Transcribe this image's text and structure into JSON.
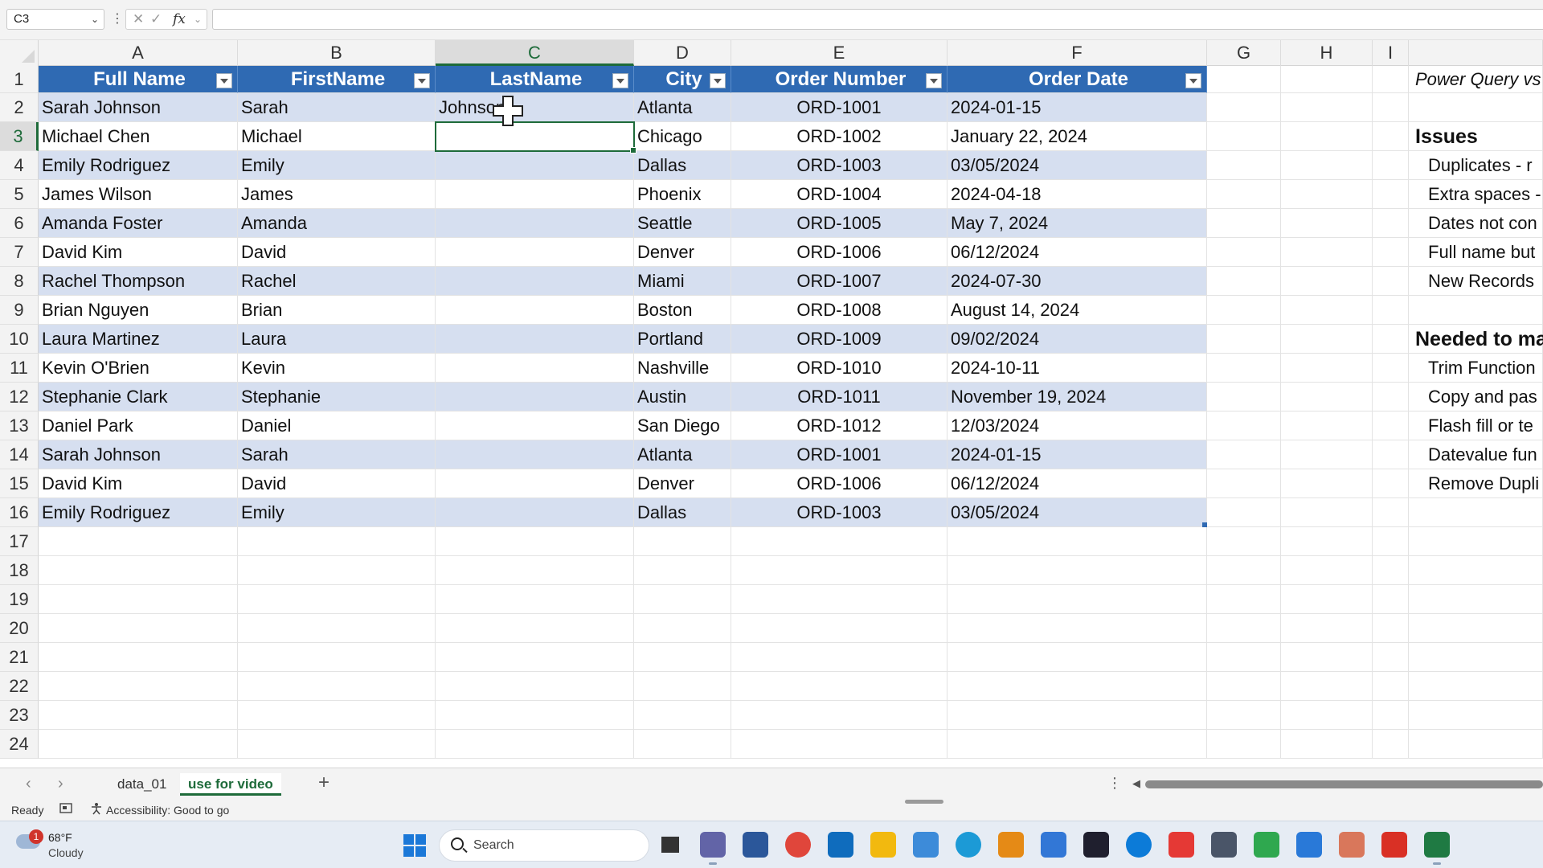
{
  "formula_bar": {
    "name_box": "C3",
    "name_box_chevron": "chevron-down-icon",
    "cancel_glyph": "✕",
    "enter_glyph": "✓",
    "fx_label": "fx",
    "formula_value": ""
  },
  "columns": [
    "A",
    "B",
    "C",
    "D",
    "E",
    "F",
    "G",
    "H",
    "I"
  ],
  "rows": [
    "1",
    "2",
    "3",
    "4",
    "5",
    "6",
    "7",
    "8",
    "9",
    "10",
    "11",
    "12",
    "13",
    "14",
    "15",
    "16",
    "17",
    "18",
    "19",
    "20",
    "21",
    "22",
    "23",
    "24"
  ],
  "table": {
    "headers": [
      "Full Name",
      "FirstName",
      "LastName",
      "City",
      "Order Number",
      "Order Date"
    ],
    "data": [
      [
        "Sarah Johnson",
        "Sarah",
        "Johnson",
        "Atlanta",
        "ORD-1001",
        "2024-01-15"
      ],
      [
        "Michael Chen",
        "Michael",
        "",
        "Chicago",
        "ORD-1002",
        "January 22, 2024"
      ],
      [
        "Emily Rodriguez",
        "Emily",
        "",
        "Dallas",
        "ORD-1003",
        "03/05/2024"
      ],
      [
        "James Wilson",
        "James",
        "",
        "Phoenix",
        "ORD-1004",
        "2024-04-18"
      ],
      [
        "Amanda Foster",
        "Amanda",
        "",
        "Seattle",
        "ORD-1005",
        "May 7, 2024"
      ],
      [
        "David Kim",
        "David",
        "",
        "Denver",
        "ORD-1006",
        "06/12/2024"
      ],
      [
        "Rachel Thompson",
        "Rachel",
        "",
        "Miami",
        "ORD-1007",
        "2024-07-30"
      ],
      [
        "Brian Nguyen",
        "Brian",
        "",
        "Boston",
        "ORD-1008",
        "August 14, 2024"
      ],
      [
        "Laura Martinez",
        "Laura",
        "",
        "Portland",
        "ORD-1009",
        "09/02/2024"
      ],
      [
        "Kevin O'Brien",
        "Kevin",
        "",
        "Nashville",
        "ORD-1010",
        "2024-10-11"
      ],
      [
        "Stephanie Clark",
        "Stephanie",
        "",
        "Austin",
        "ORD-1011",
        "November 19, 2024"
      ],
      [
        "Daniel Park",
        "Daniel",
        "",
        "San Diego",
        "ORD-1012",
        "12/03/2024"
      ],
      [
        "Sarah Johnson",
        "Sarah",
        "",
        "Atlanta",
        "ORD-1001",
        "2024-01-15"
      ],
      [
        "David Kim",
        "David",
        "",
        "Denver",
        "ORD-1006",
        "06/12/2024"
      ],
      [
        "Emily Rodriguez",
        "Emily",
        "",
        "Dallas",
        "ORD-1003",
        "03/05/2024"
      ]
    ]
  },
  "notes": {
    "title": "Power Query vs",
    "issues_heading": "Issues",
    "issues": [
      "Duplicates - r",
      "Extra spaces -",
      "Dates not con",
      "Full name but",
      "New Records"
    ],
    "needed_heading": "Needed to ma",
    "needed": [
      "Trim Function",
      "Copy and pas",
      "Flash fill or te",
      "Datevalue fun",
      "Remove Dupli"
    ]
  },
  "sheet_tabs": {
    "prev_icon": "chevron-left-icon",
    "next_icon": "chevron-right-icon",
    "tabs": [
      "data_01",
      "use for video"
    ],
    "active_tab": "use for video",
    "add_glyph": "+"
  },
  "status_bar": {
    "ready": "Ready",
    "accessibility": "Accessibility: Good to go"
  },
  "taskbar": {
    "weather_temp": "68°F",
    "weather_cond": "Cloudy",
    "weather_badge": "1",
    "search_label": "Search",
    "apps": [
      {
        "name": "task-view-icon",
        "color": "#3a3a3a"
      },
      {
        "name": "teams-icon",
        "color": "#6264a7"
      },
      {
        "name": "m365-icon",
        "color": "#2b579a"
      },
      {
        "name": "chrome-icon",
        "color": "#e0463b"
      },
      {
        "name": "outlook-icon",
        "color": "#0f6cbd"
      },
      {
        "name": "file-explorer-icon",
        "color": "#f2b90f"
      },
      {
        "name": "network-app-icon",
        "color": "#3d8bd9"
      },
      {
        "name": "edge-icon",
        "color": "#1c9ad6"
      },
      {
        "name": "notes-app-icon",
        "color": "#e58a16"
      },
      {
        "name": "grid-app-icon",
        "color": "#3277d6"
      },
      {
        "name": "stats-app-icon",
        "color": "#1f1f2e"
      },
      {
        "name": "edge-browser-icon",
        "color": "#0c7bd8"
      },
      {
        "name": "s-app-red-icon",
        "color": "#e53935"
      },
      {
        "name": "window-app-icon",
        "color": "#4a5568"
      },
      {
        "name": "c-app-green-icon",
        "color": "#2fa84f"
      },
      {
        "name": "s-app-blue-icon",
        "color": "#2979d8"
      },
      {
        "name": "claude-icon",
        "color": "#d9775b"
      },
      {
        "name": "c-app-red-icon",
        "color": "#d93025"
      },
      {
        "name": "excel-icon",
        "color": "#1f7a43"
      }
    ]
  },
  "colors": {
    "header_blue": "#2f6ab3",
    "band_blue": "#d6dff0",
    "excel_green": "#1e6b3a"
  }
}
